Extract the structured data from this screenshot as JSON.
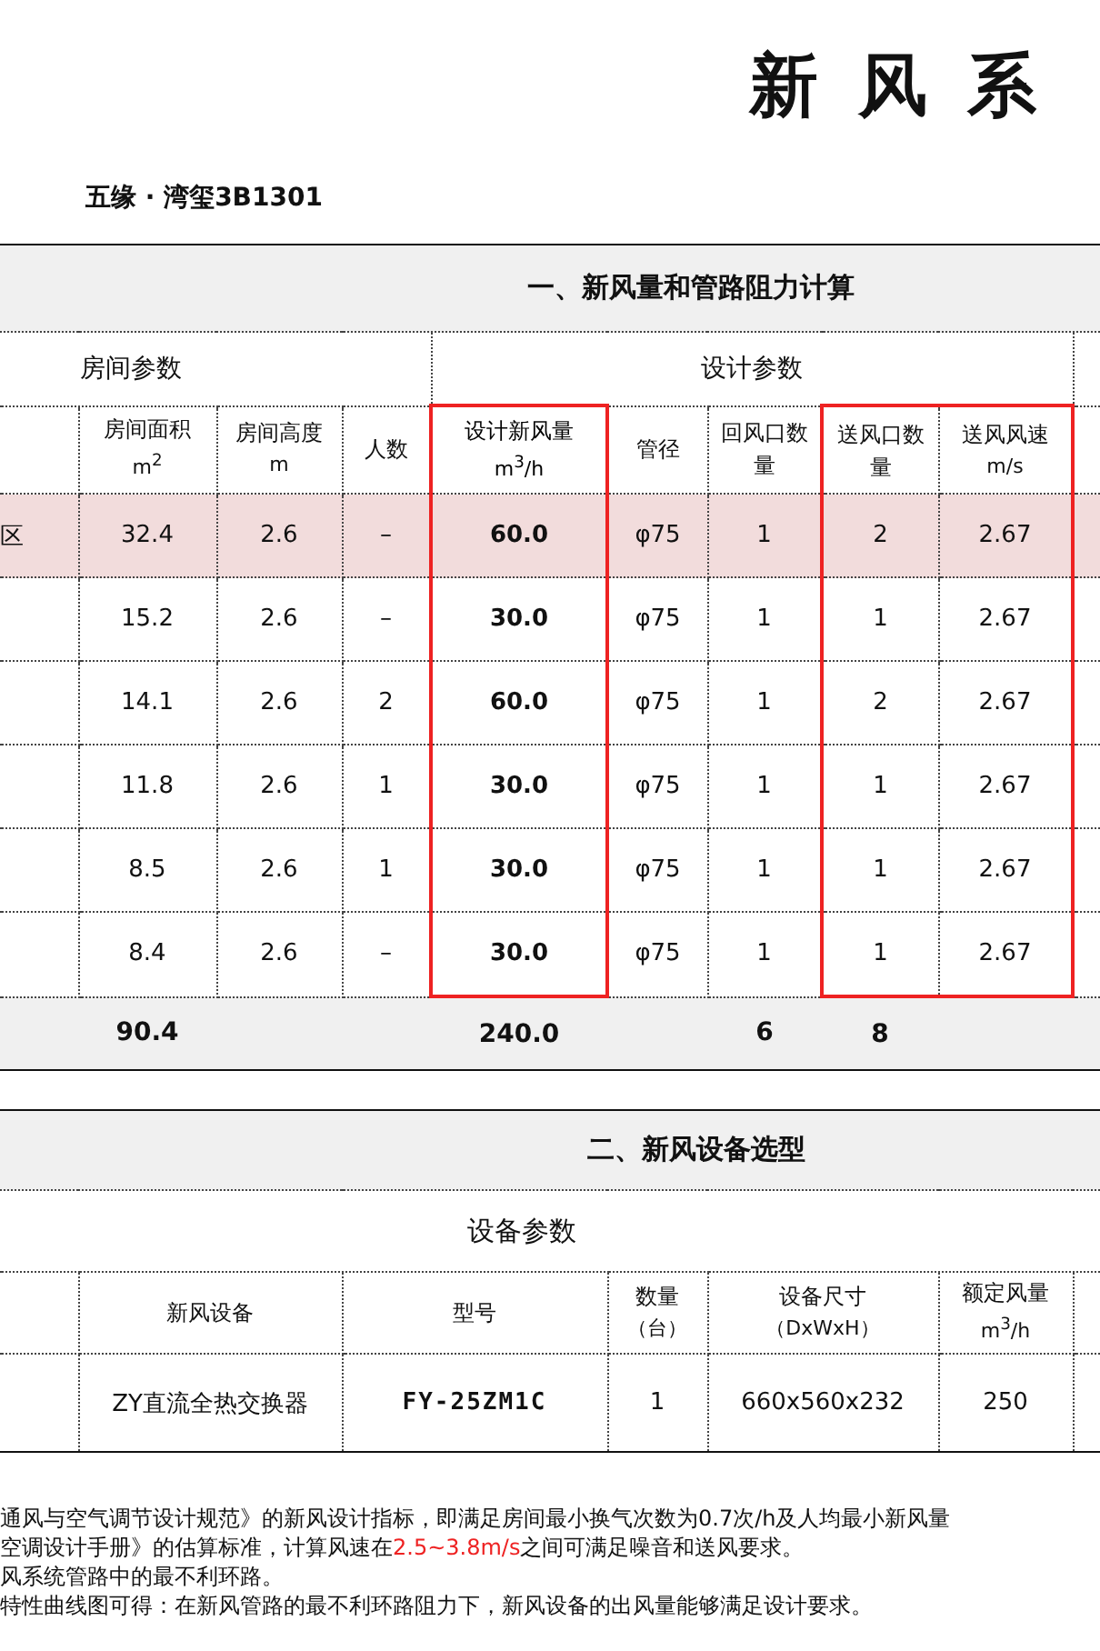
{
  "title": "新风系",
  "project": "五缘 · 湾玺3B1301",
  "calc": {
    "section_title": "一、新风量和管路阻力计算",
    "groups": [
      {
        "label": "房间参数",
        "columns": [
          {
            "label": "房间面积",
            "unit": "m$^{2}$",
            "emphasis": false,
            "highlighted": false,
            "total": "90.4"
          },
          {
            "label": "房间高度",
            "unit": "m",
            "emphasis": false,
            "highlighted": false
          },
          {
            "label": "人数",
            "emphasis": false,
            "highlighted": false
          }
        ]
      },
      {
        "label": "设计参数",
        "columns": [
          {
            "label": "设计新风量",
            "unit": "m$^{3}$/h",
            "emphasis": true,
            "highlighted": true,
            "total": "240.0"
          },
          {
            "label": "管径",
            "emphasis": false,
            "highlighted": false
          },
          {
            "label": "回风口数量",
            "emphasis": false,
            "highlighted": false,
            "total": "6"
          },
          {
            "label": "送风口数量",
            "emphasis": false,
            "highlighted": true,
            "total": "8"
          },
          {
            "label": "送风风速",
            "unit": "m/s",
            "emphasis": false,
            "highlighted": true
          }
        ]
      }
    ],
    "rows": [
      {
        "room": "区",
        "selected": true,
        "cells": [
          "32.4",
          "2.6",
          "–",
          "60.0",
          "φ75",
          "1",
          "2",
          "2.67"
        ]
      },
      {
        "selected": false,
        "cells": [
          "15.2",
          "2.6",
          "–",
          "30.0",
          "φ75",
          "1",
          "1",
          "2.67"
        ]
      },
      {
        "selected": false,
        "cells": [
          "14.1",
          "2.6",
          "2",
          "60.0",
          "φ75",
          "1",
          "2",
          "2.67"
        ]
      },
      {
        "selected": false,
        "cells": [
          "11.8",
          "2.6",
          "1",
          "30.0",
          "φ75",
          "1",
          "1",
          "2.67"
        ]
      },
      {
        "selected": false,
        "cells": [
          "8.5",
          "2.6",
          "1",
          "30.0",
          "φ75",
          "1",
          "1",
          "2.67"
        ]
      },
      {
        "selected": false,
        "cells": [
          "8.4",
          "2.6",
          "–",
          "30.0",
          "φ75",
          "1",
          "1",
          "2.67"
        ]
      }
    ]
  },
  "equipment": {
    "section_title": "二、新风设备选型",
    "group": "设备参数",
    "columns": [
      {
        "label": "新风设备"
      },
      {
        "label": "型号"
      },
      {
        "label": "数量",
        "unit": "（台）"
      },
      {
        "label": "设备尺寸",
        "unit": "（DxWxH）"
      },
      {
        "label": "额定风量",
        "unit": "m$^{3}$/h"
      }
    ],
    "rows": [
      {
        "cells": [
          "ZY直流全热交换器",
          "FY-25ZM1C",
          "1",
          "660x560x232",
          "250"
        ]
      }
    ]
  },
  "notes": [
    [
      {
        "text": "通风与空气调节设计规范》的新风设计指标，即满足房间最小换气次数为0.7次/h及人均最小新风量",
        "highlight": false
      }
    ],
    [
      {
        "text": "空调设计手册》的估算标准，计算风速在",
        "highlight": false
      },
      {
        "text": "2.5~3.8m/s",
        "highlight": true
      },
      {
        "text": "之间可满足噪音和送风要求。",
        "highlight": false
      }
    ],
    [
      {
        "text": "风系统管路中的最不利环路。",
        "highlight": false
      }
    ],
    [
      {
        "text": "特性曲线图可得：在新风管路的最不利环路阻力下，新风设备的出风量能够满足设计要求。",
        "highlight": false
      }
    ]
  ]
}
